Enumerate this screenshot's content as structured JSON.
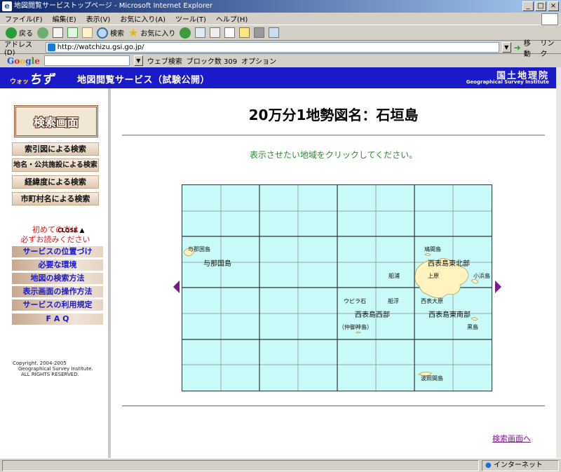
{
  "window": {
    "title": "地図閲覧サービストップページ - Microsoft Internet Explorer",
    "controls": [
      "_",
      "□",
      "×"
    ]
  },
  "menu": [
    "ファイル(F)",
    "編集(E)",
    "表示(V)",
    "お気に入り(A)",
    "ツール(T)",
    "ヘルプ(H)"
  ],
  "toolbar": {
    "back": "戻る",
    "search": "検索",
    "favorites": "お気に入り"
  },
  "address": {
    "label": "アドレス(D)",
    "url": "http://watchizu.gsi.go.jp/",
    "go": "移動",
    "links": "リンク"
  },
  "google": {
    "brand": "Google",
    "web_search": "ウェブ検索",
    "popup_blocked": "ブロック数 309",
    "options": "オプション"
  },
  "banner": {
    "logo_small": "ウォッ",
    "logo": "ちず",
    "service": "地図閲覧サービス（試験公開）",
    "gsi_ja": "国土地理院",
    "gsi_en": "Geographical Survey Institute"
  },
  "sidebar": {
    "search_screen": "検索画面",
    "search_buttons": [
      "索引図による検索",
      "地名・公共施設による検索",
      "経緯度による検索",
      "市町村名による検索"
    ],
    "close": "CLOSE",
    "first_time": [
      "初めての方は",
      "必ずお読みください"
    ],
    "info_buttons": [
      "サービスの位置づけ",
      "必要な環境",
      "地図の検索方法",
      "表示画面の操作方法",
      "サービスの利用規定",
      "F A Q"
    ],
    "copyright": [
      "Copyright. 2004-2005",
      "Geographical Survey Institute.",
      "ALL RIGHTS RESERVED."
    ]
  },
  "main": {
    "title": "20万分1地勢図名：石垣島",
    "instruction": "表示させたい地域をクリックしてください。",
    "back_link": "検索画面へ"
  },
  "map_labels": {
    "yonaguni_small": "与那国島",
    "yonaguni": "与那国島",
    "hatoma": "鳩間島",
    "iriomote_ne": "西表島東北部",
    "funaura": "船浦",
    "uehara": "上原",
    "kohama": "小浜島",
    "upirashi": "ウピラ石",
    "funauki": "船浮",
    "ohara": "西表大原",
    "iriomote_w": "西表島西部",
    "iriomote_se": "西表島東南部",
    "nakanouganjima": "（仲御神島）",
    "kuroshima": "黒島",
    "haterumajima": "波照間島"
  },
  "status": {
    "zone": "インターネット"
  },
  "colors": {
    "banner": "#1a1ac8",
    "map_sea": "#c8fafa",
    "land": "#fff4c0",
    "instruction": "#2e8b2e",
    "link": "#7a1a8a"
  }
}
